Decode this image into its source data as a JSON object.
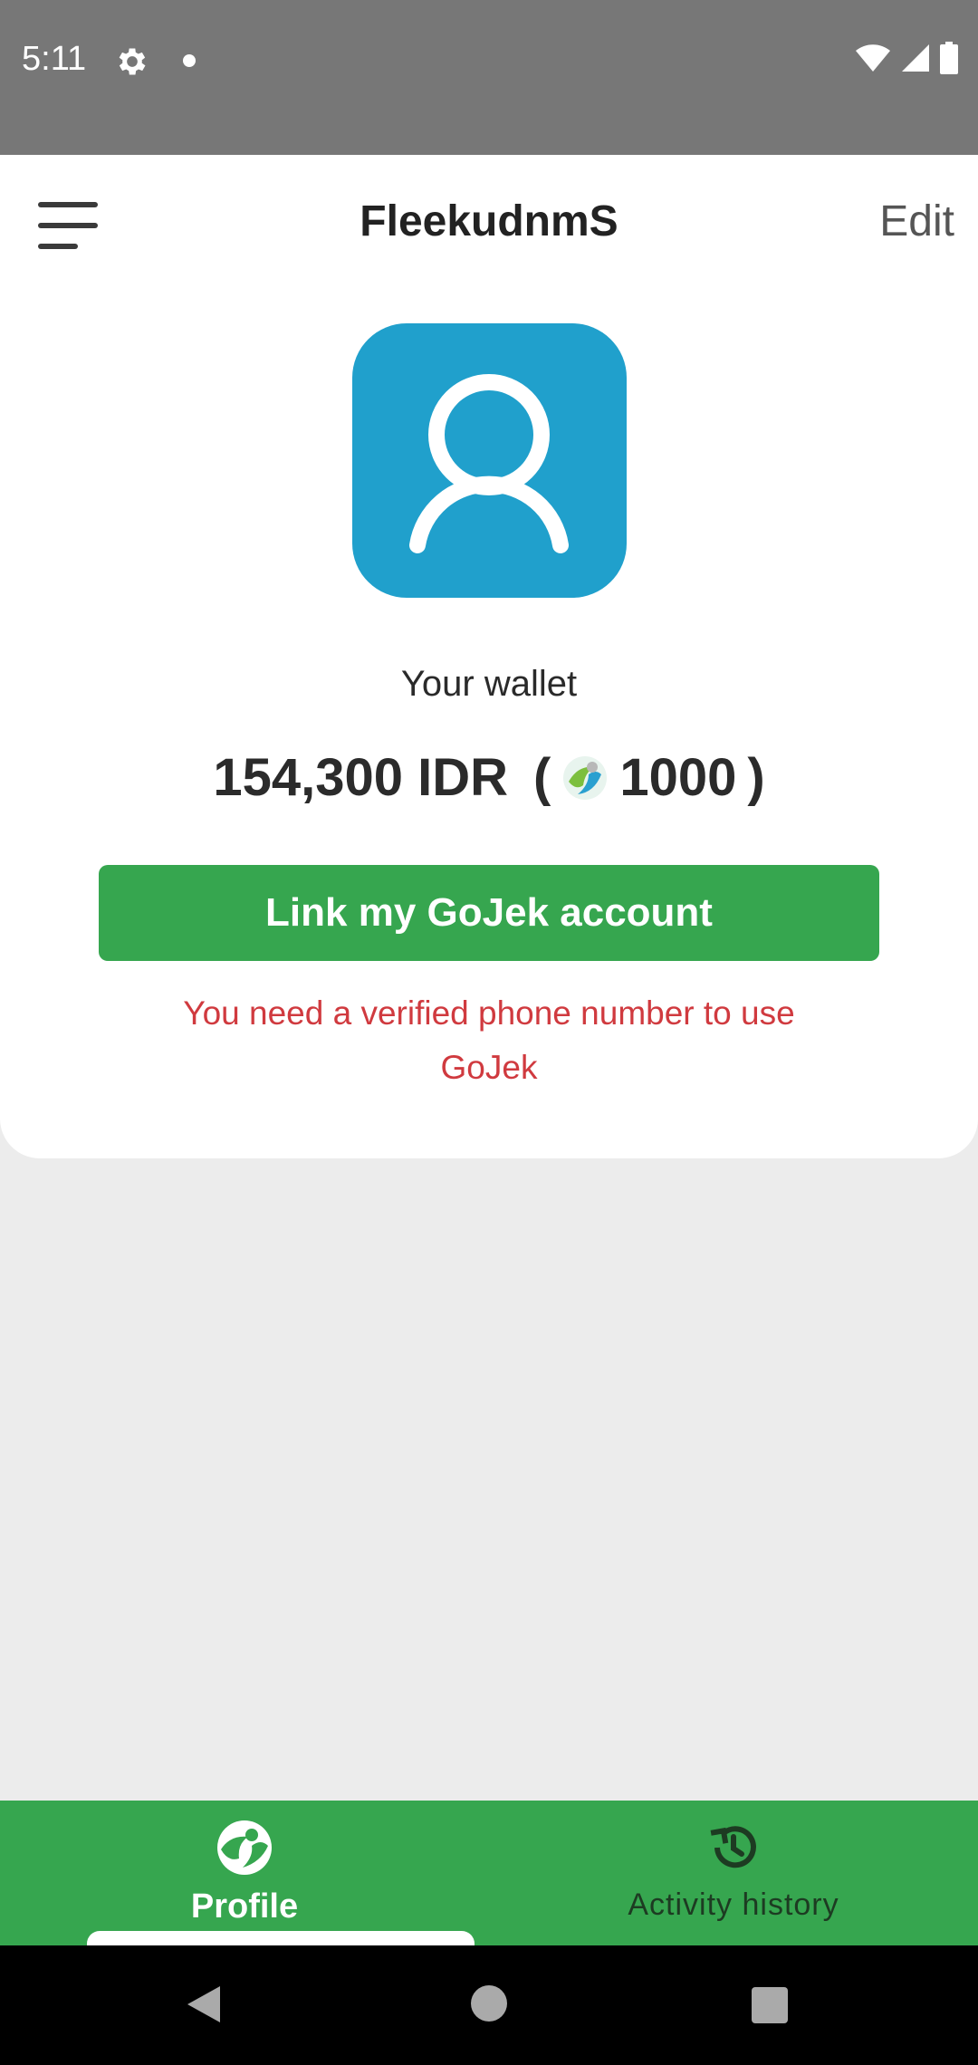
{
  "status_bar": {
    "time": "5:11",
    "icons": [
      "settings-icon",
      "notification-dot-icon",
      "wifi-icon",
      "signal-icon",
      "battery-icon"
    ]
  },
  "header": {
    "title": "FleekudnmS",
    "edit_label": "Edit",
    "menu_icon": "hamburger-menu-icon"
  },
  "profile": {
    "avatar_icon": "user-avatar-icon",
    "avatar_color": "#20a0cc",
    "wallet_label": "Your wallet",
    "balance_idr": "154,300 IDR",
    "paren_open": "(",
    "coin_amount": "1000",
    "paren_close": ")",
    "coin_icon": "coin-icon"
  },
  "actions": {
    "link_button_label": "Link my GoJek account",
    "link_button_color": "#36a64f",
    "warning_text": "You need a verified phone number to use GoJek",
    "warning_color": "#d03a3f"
  },
  "bottom_nav": {
    "items": [
      {
        "label": "Profile",
        "icon": "profile-leaf-icon",
        "active": true
      },
      {
        "label": "Activity history",
        "icon": "history-icon",
        "active": false
      }
    ]
  },
  "system_nav": {
    "icons": [
      "back-icon",
      "home-icon",
      "recents-icon"
    ]
  }
}
